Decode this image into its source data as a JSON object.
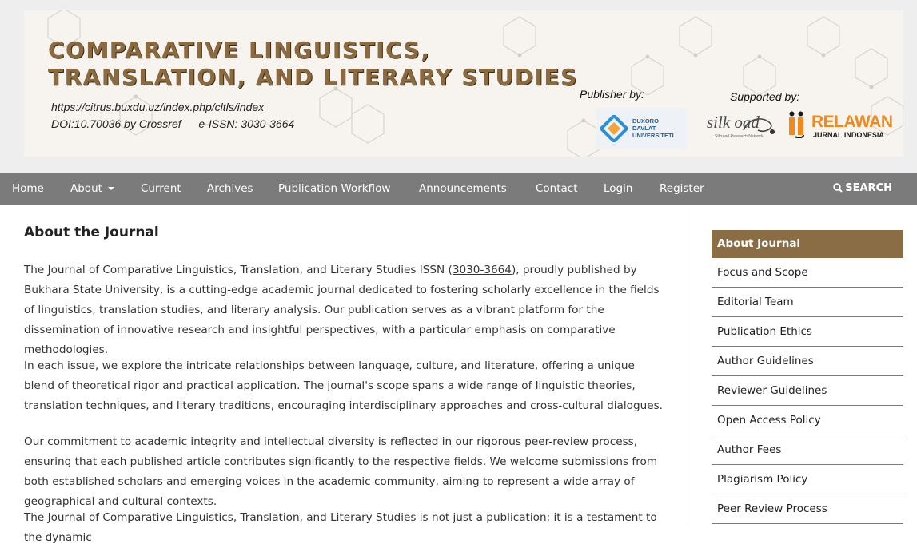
{
  "banner": {
    "title_line1": "COMPARATIVE LINGUISTICS,",
    "title_line2": "TRANSLATION, AND LITERARY STUDIES",
    "url": "https://citrus.buxdu.uz/index.php/cltls/index",
    "doi": "DOI:10.70036 by Crossref",
    "issn": "e-ISSN: 3030-3664",
    "publisher_label": "Publisher by:",
    "supported_label": "Supported by:",
    "publisher_logo_text": [
      "BUXORO",
      "DAVLAT",
      "UNIVERSITETI"
    ],
    "silkroad_text": "silk oad",
    "silkroad_sub": "Silkroad Research Network",
    "relawan_text": "RELAWAN",
    "relawan_sub": "JURNAL INDONESIA"
  },
  "nav": {
    "items": [
      "Home",
      "About",
      "Current",
      "Archives",
      "Publication Workflow",
      "Announcements",
      "Contact",
      "Login",
      "Register"
    ],
    "search_label": "SEARCH"
  },
  "main": {
    "title": "About the Journal",
    "issn_link": "3030-3664",
    "p1_before": "The Journal of Comparative Linguistics, Translation, and Literary Studies ISSN (",
    "p1_after": "), proudly published by Bukhara State University, is a cutting-edge academic journal dedicated to fostering scholarly excellence in the fields of linguistics, translation studies, and literary analysis. Our publication serves as a vibrant platform for the dissemination of innovative research and insightful perspectives, with a particular emphasis on comparative methodologies.",
    "p2": "In each issue, we explore the intricate relationships between language, culture, and literature, offering a unique blend of theoretical rigor and practical application. The journal's scope spans a wide range of linguistic theories, translation techniques, and literary traditions, encouraging interdisciplinary approaches and cross-cultural dialogues.",
    "p3": "Our commitment to academic integrity and intellectual diversity is reflected in our rigorous peer-review process, ensuring that each published article contributes significantly to the respective fields. We welcome submissions from both established scholars and emerging voices in the academic community, aiming to represent a wide array of geographical and cultural contexts.",
    "p4": "The Journal of Comparative Linguistics, Translation, and Literary Studies is not just a publication; it is a testament to the dynamic"
  },
  "sidebar": {
    "heading": "About Journal",
    "items": [
      "Focus and Scope",
      "Editorial Team",
      "Publication Ethics",
      "Author Guidelines",
      "Reviewer Guidelines",
      "Open Access Policy",
      "Author Fees",
      "Plagiarism Policy",
      "Peer Review Process"
    ]
  },
  "colors": {
    "nav_bg": "#7b7b7b",
    "sidebar_head_bg": "#8b6d45",
    "title_brown": "#8a6a3e",
    "relawan_orange": "#f08a1c"
  }
}
